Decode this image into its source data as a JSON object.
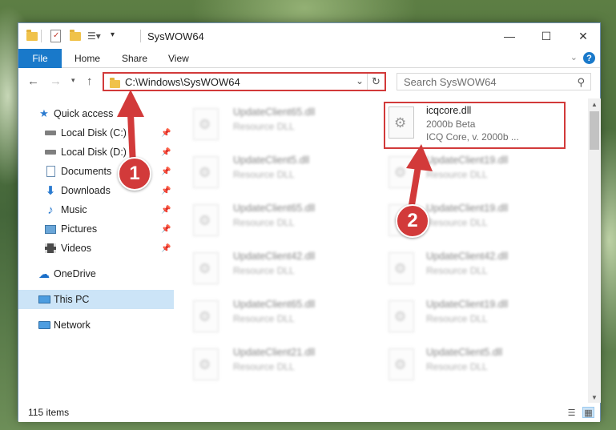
{
  "window": {
    "title": "SysWOW64",
    "controls": {
      "minimize": "—",
      "maximize": "☐",
      "close": "✕"
    }
  },
  "ribbon": {
    "tabs": [
      "File",
      "Home",
      "Share",
      "View"
    ],
    "help": "?"
  },
  "address": {
    "path": "C:\\Windows\\SysWOW64",
    "search_placeholder": "Search SysWOW64"
  },
  "nav": {
    "items": [
      {
        "label": "Quick access",
        "icon": "star-icon",
        "pinned": false
      },
      {
        "label": "Local Disk (C:)",
        "icon": "drive-icon",
        "pinned": true
      },
      {
        "label": "Local Disk (D:)",
        "icon": "drive-icon",
        "pinned": true
      },
      {
        "label": "Documents",
        "icon": "documents-icon",
        "pinned": true
      },
      {
        "label": "Downloads",
        "icon": "downloads-icon",
        "pinned": true
      },
      {
        "label": "Music",
        "icon": "music-icon",
        "pinned": true
      },
      {
        "label": "Pictures",
        "icon": "pictures-icon",
        "pinned": true
      },
      {
        "label": "Videos",
        "icon": "videos-icon",
        "pinned": true
      },
      {
        "label": "OneDrive",
        "icon": "cloud-icon",
        "pinned": false
      },
      {
        "label": "This PC",
        "icon": "computer-icon",
        "pinned": false,
        "selected": true
      },
      {
        "label": "Network",
        "icon": "network-icon",
        "pinned": false
      }
    ]
  },
  "files": {
    "highlighted": {
      "name": "icqcore.dll",
      "version": "2000b Beta",
      "description": "ICQ Core, v. 2000b ..."
    },
    "left_column": [
      {
        "name": "UpdateClient65.dll",
        "type": "Resource DLL"
      },
      {
        "name": "UpdateClient5.dll",
        "type": "Resource DLL"
      },
      {
        "name": "UpdateClient65.dll",
        "type": "Resource DLL"
      },
      {
        "name": "UpdateClient42.dll",
        "type": "Resource DLL"
      },
      {
        "name": "UpdateClient65.dll",
        "type": "Resource DLL"
      },
      {
        "name": "UpdateClient21.dll",
        "type": "Resource DLL"
      }
    ],
    "right_column": [
      {
        "name": "UpdateClient19.dll",
        "type": "Resource DLL"
      },
      {
        "name": "UpdateClient19.dll",
        "type": "Resource DLL"
      },
      {
        "name": "UpdateClient42.dll",
        "type": "Resource DLL"
      },
      {
        "name": "UpdateClient19.dll",
        "type": "Resource DLL"
      },
      {
        "name": "UpdateClient5.dll",
        "type": "Resource DLL"
      }
    ]
  },
  "status": {
    "item_count": "115 items"
  },
  "annotations": {
    "step1": "1",
    "step2": "2",
    "color": "#d23a3a"
  }
}
